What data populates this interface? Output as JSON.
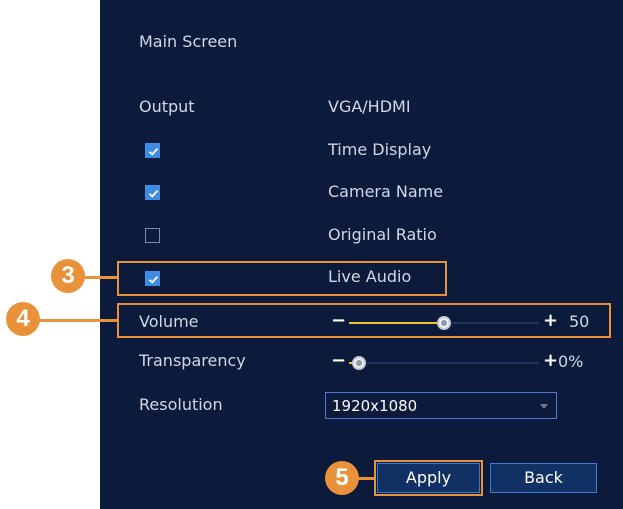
{
  "panel": {
    "heading": "Main Screen",
    "output_label": "Output",
    "output_value": "VGA/HDMI",
    "options": [
      {
        "label": "Time Display",
        "checked": true
      },
      {
        "label": "Camera Name",
        "checked": true
      },
      {
        "label": "Original Ratio",
        "checked": false
      },
      {
        "label": "Live Audio",
        "checked": true
      }
    ],
    "volume": {
      "label": "Volume",
      "minus": "−",
      "plus": "+",
      "value": "50",
      "level": 0.5
    },
    "transparency": {
      "label": "Transparency",
      "minus": "−",
      "plus": "+",
      "value": "0%",
      "level": 0.0
    },
    "resolution": {
      "label": "Resolution",
      "selected": "1920x1080"
    },
    "buttons": {
      "apply": "Apply",
      "back": "Back"
    }
  },
  "callouts": {
    "step3": "3",
    "step4": "4",
    "step5": "5"
  },
  "colors": {
    "panel_bg": "#0c1b3b",
    "accent": "#3f8de3",
    "callout": "#e9923a",
    "slider_fill": "#f2c531"
  },
  "icons": [
    "checkmark-icon",
    "dropdown-arrow-icon",
    "slider-knob-icon"
  ]
}
